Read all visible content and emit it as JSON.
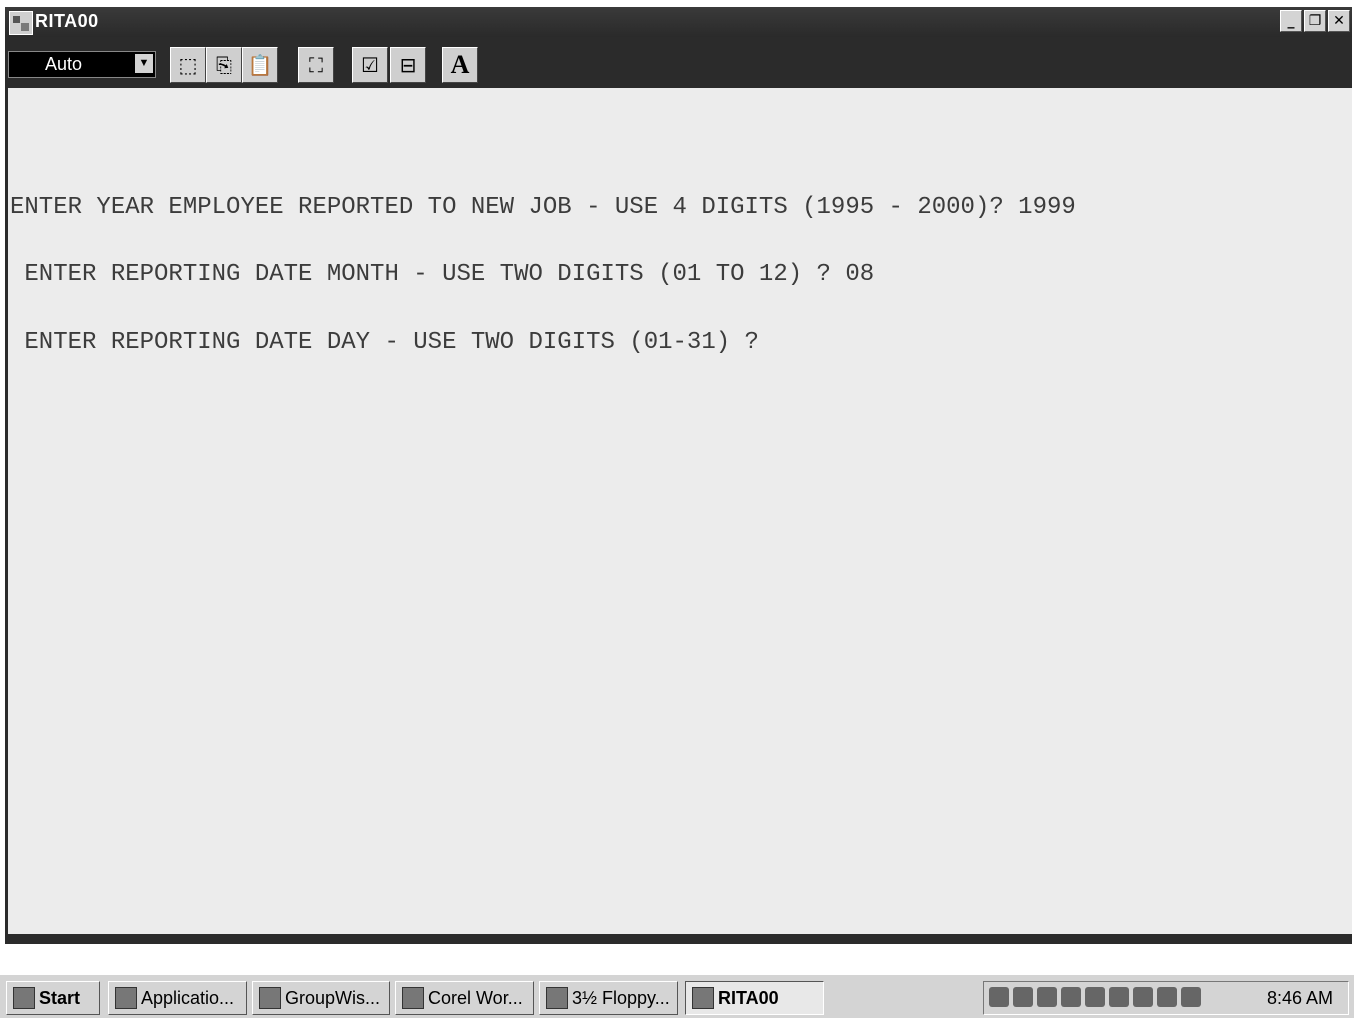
{
  "window": {
    "title": "RITA00",
    "controls": {
      "minimize": "_",
      "restore": "❐",
      "close": "✕"
    }
  },
  "toolbar": {
    "font_size_value": "Auto",
    "buttons": [
      {
        "name": "mark-button",
        "glyph": "⬚"
      },
      {
        "name": "copy-button",
        "glyph": "⎘"
      },
      {
        "name": "paste-button",
        "glyph": "📋"
      },
      {
        "name": "fullscreen-button",
        "glyph": "⛶"
      },
      {
        "name": "properties-button",
        "glyph": "☑"
      },
      {
        "name": "background-button",
        "glyph": "⊟"
      },
      {
        "name": "font-button",
        "glyph": "A"
      }
    ]
  },
  "console": {
    "lines": [
      "ENTER YEAR EMPLOYEE REPORTED TO NEW JOB - USE 4 DIGITS (1995 - 2000)? 1999",
      " ENTER REPORTING DATE MONTH - USE TWO DIGITS (01 TO 12) ? 08",
      " ENTER REPORTING DATE DAY - USE TWO DIGITS (01-31) ?"
    ]
  },
  "taskbar": {
    "start_label": "Start",
    "items": [
      {
        "label": "Applicatio...",
        "icon": "application-icon"
      },
      {
        "label": "GroupWis...",
        "icon": "groupwise-icon"
      },
      {
        "label": "Corel Wor...",
        "icon": "corel-icon"
      },
      {
        "label": "3½ Floppy...",
        "icon": "floppy-icon"
      },
      {
        "label": "RITA00",
        "icon": "dos-icon",
        "active": true
      }
    ],
    "clock": "8:46 AM"
  },
  "colors": {
    "title_bar": "#2b2b2b",
    "console_bg": "#ececec",
    "console_text": "#3c3c3c",
    "taskbar_bg": "#d4d4d4"
  }
}
